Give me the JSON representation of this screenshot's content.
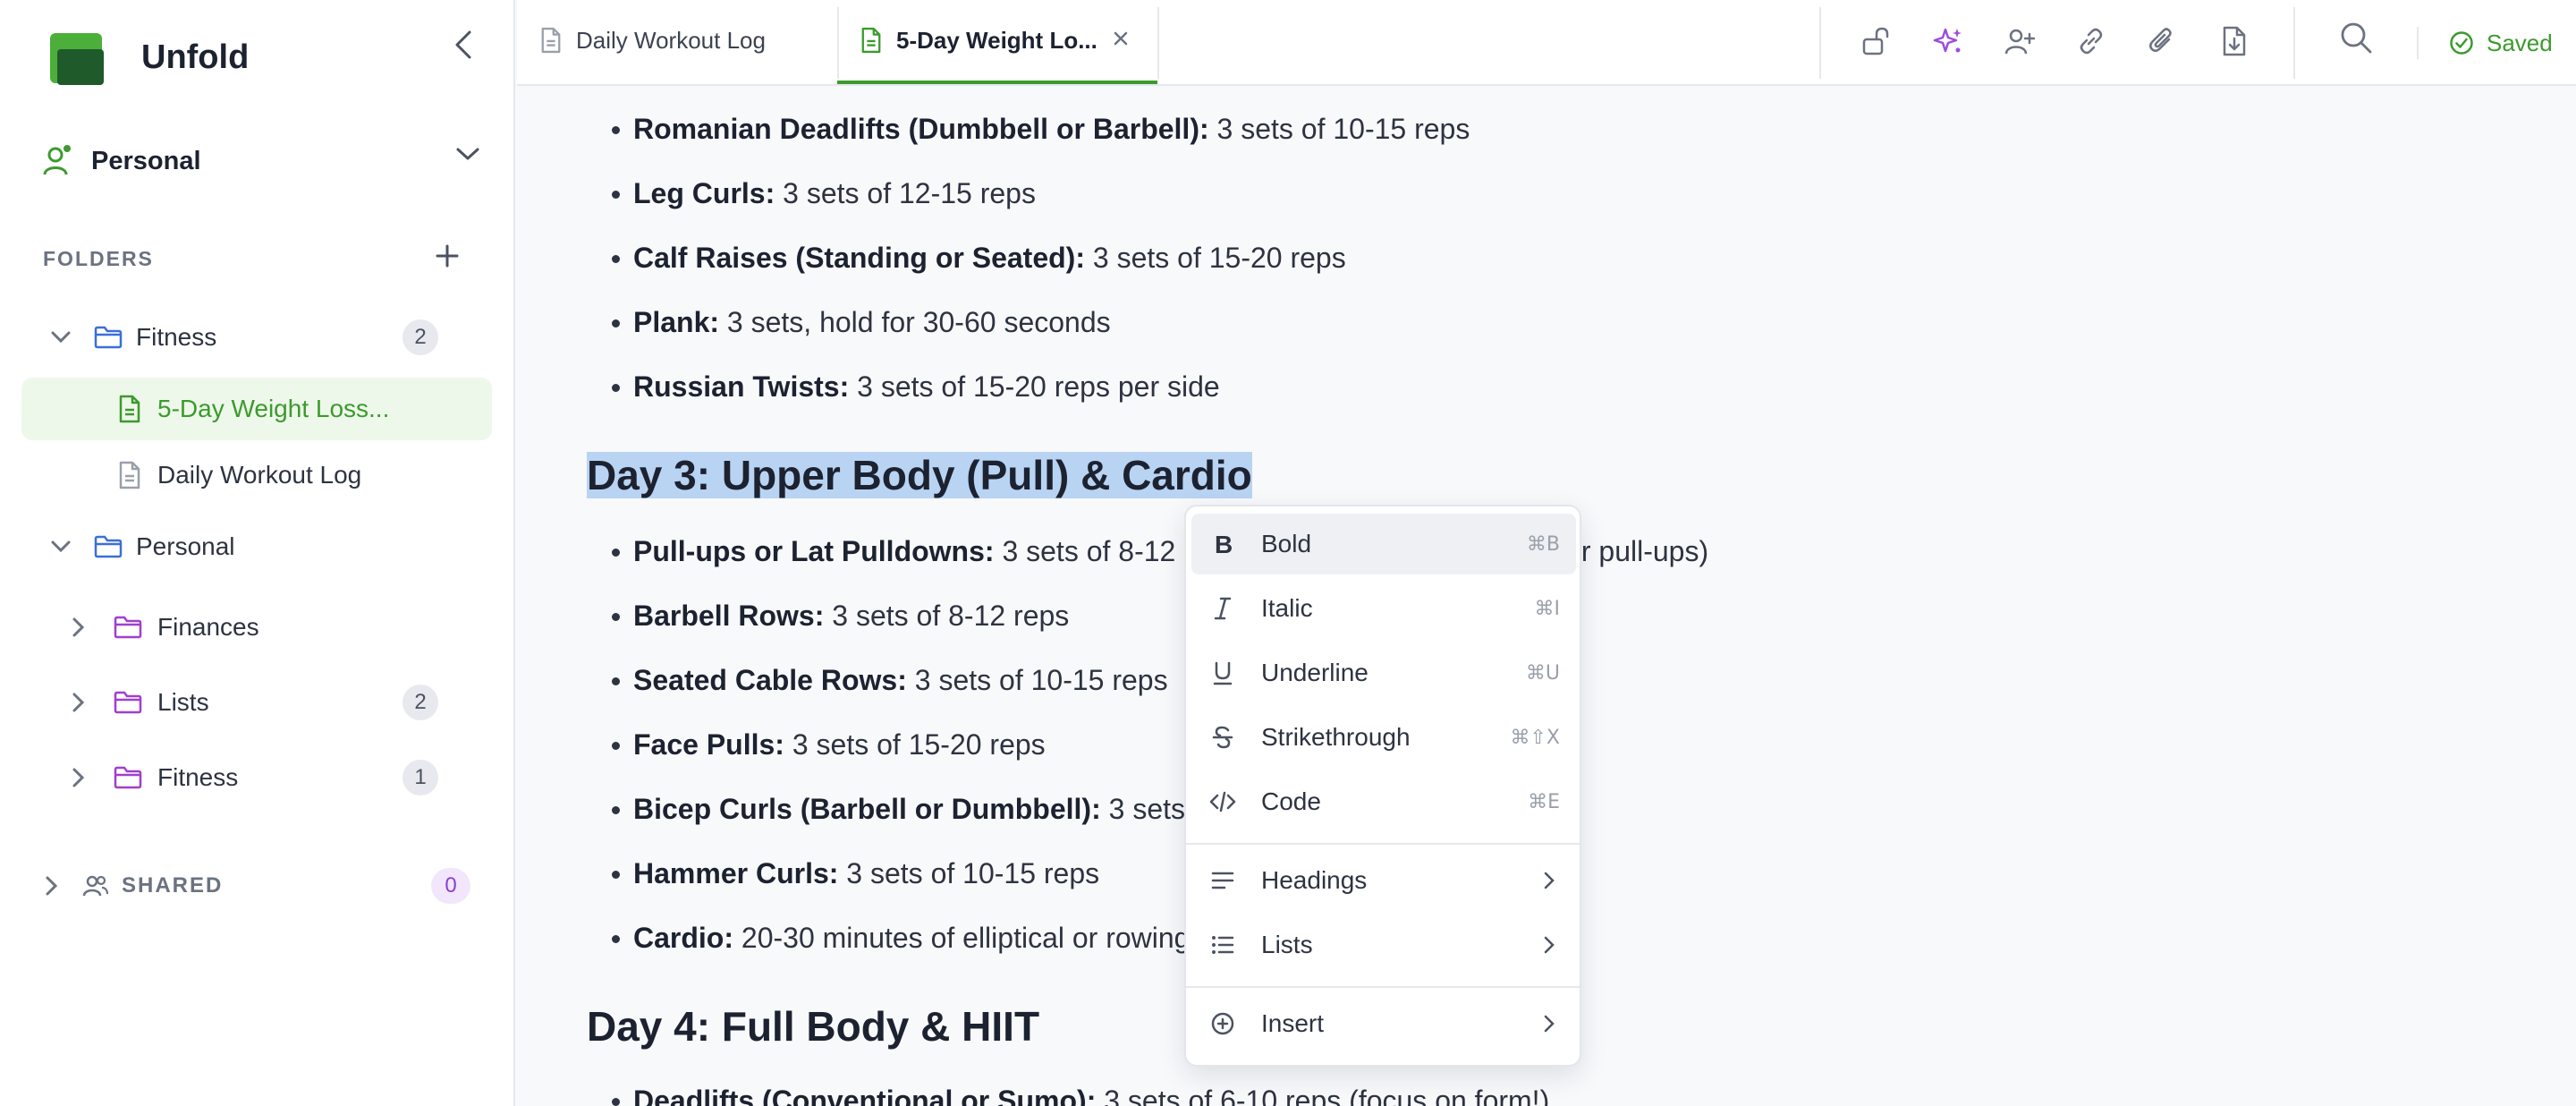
{
  "app": {
    "name": "Unfold"
  },
  "workspace": {
    "label": "Personal"
  },
  "sidebar": {
    "folders_title": "FOLDERS",
    "tree": [
      {
        "label": "Fitness",
        "count": "2"
      },
      {
        "label": "5-Day Weight Loss..."
      },
      {
        "label": "Daily Workout Log"
      },
      {
        "label": "Personal"
      },
      {
        "label": "Finances"
      },
      {
        "label": "Lists",
        "count": "2"
      },
      {
        "label": "Fitness",
        "count": "1"
      }
    ],
    "shared": {
      "label": "SHARED",
      "count": "0"
    }
  },
  "tabs": [
    {
      "label": "Daily Workout Log"
    },
    {
      "label": "5-Day Weight Lo..."
    }
  ],
  "status": {
    "saved": "Saved"
  },
  "colors": {
    "accent": "#3c9a2e",
    "ai": "#9b4de0",
    "selection": "#b9d3f3",
    "folder_blue": "#3a6fd8",
    "folder_purple": "#a03fd0"
  },
  "doc": {
    "items_top": [
      {
        "bold": "Romanian Deadlifts (Dumbbell or Barbell):",
        "text": " 3 sets of 10-15 reps"
      },
      {
        "bold": "Leg Curls:",
        "text": " 3 sets of 12-15 reps"
      },
      {
        "bold": "Calf Raises (Standing or Seated):",
        "text": " 3 sets of 15-20 reps"
      },
      {
        "bold": "Plank:",
        "text": " 3 sets, hold for 30-60 seconds"
      },
      {
        "bold": "Russian Twists:",
        "text": " 3 sets of 15-20 reps per side"
      }
    ],
    "day3_heading": "Day 3: Upper Body (Pull) & Cardio",
    "items_day3": [
      {
        "bold": "Pull-ups or Lat Pulldowns:",
        "text": " 3 sets of 8-12 reps (or as many as possible for pull-ups)"
      },
      {
        "bold": "Barbell Rows:",
        "text": " 3 sets of 8-12 reps"
      },
      {
        "bold": "Seated Cable Rows:",
        "text": " 3 sets of 10-15 reps"
      },
      {
        "bold": "Face Pulls:",
        "text": " 3 sets of 15-20 reps"
      },
      {
        "bold": "Bicep Curls (Barbell or Dumbbell):",
        "text": " 3 sets of 10-15 reps"
      },
      {
        "bold": "Hammer Curls:",
        "text": " 3 sets of 10-15 reps"
      },
      {
        "bold": "Cardio:",
        "text": " 20-30 minutes of elliptical or rowing"
      }
    ],
    "day4_heading": "Day 4: Full Body & HIIT",
    "items_day4": [
      {
        "bold": "Deadlifts (Conventional or Sumo):",
        "text": " 3 sets of 6-10 reps (focus on form!)"
      }
    ]
  },
  "context_menu": {
    "items": [
      {
        "label": "Bold",
        "shortcut": "⌘B"
      },
      {
        "label": "Italic",
        "shortcut": "⌘I"
      },
      {
        "label": "Underline",
        "shortcut": "⌘U"
      },
      {
        "label": "Strikethrough",
        "shortcut": "⌘⇧X"
      },
      {
        "label": "Code",
        "shortcut": "⌘E"
      },
      {
        "label": "Headings"
      },
      {
        "label": "Lists"
      },
      {
        "label": "Insert"
      }
    ]
  }
}
